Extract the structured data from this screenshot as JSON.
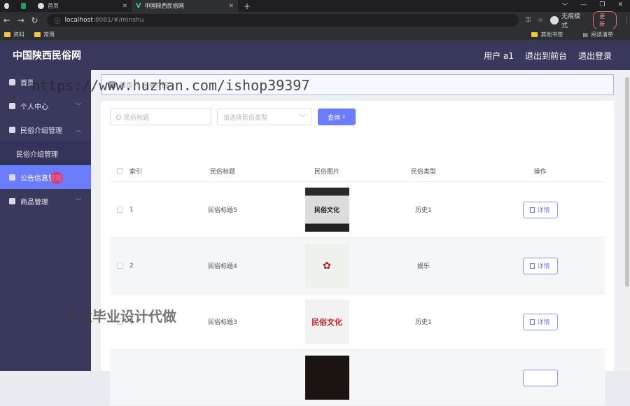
{
  "browser": {
    "tabs": [
      {
        "label": ""
      },
      {
        "label": ""
      },
      {
        "label": "首页"
      },
      {
        "label": "中国陕西民俗网"
      }
    ],
    "new_tab": "+",
    "window_controls": [
      "﹀",
      "—",
      "❐",
      "✕"
    ],
    "url_host": "localhost",
    "url_rest": ":8081/#/minshu",
    "incognito_label": "无痕模式",
    "update_label": "更新",
    "bookmarks": [
      "资料",
      "常用"
    ],
    "bookmarks_right": [
      "其他书签",
      "阅读清单"
    ]
  },
  "header": {
    "brand": "中国陕西民俗网",
    "user": "用户 a1",
    "back_front": "退出到前台",
    "logout": "退出登录"
  },
  "sidebar": {
    "items": [
      {
        "label": "首页",
        "icon": "home-icon"
      },
      {
        "label": "个人中心",
        "icon": "user-icon"
      },
      {
        "label": "民俗介绍管理",
        "icon": "clipboard-icon"
      },
      {
        "label": "民俗介绍管理",
        "icon": ""
      },
      {
        "label": "公告信息管理",
        "icon": "notice-icon"
      },
      {
        "label": "商品管理",
        "icon": "goods-icon"
      }
    ]
  },
  "breadcrumb": {
    "home": "首页",
    "current": "民俗介绍"
  },
  "search": {
    "title_placeholder": "民俗标题",
    "type_placeholder": "请选择民俗类型",
    "query_label": "查询"
  },
  "table": {
    "headers": {
      "index": "索引",
      "title": "民俗标题",
      "image": "民俗图片",
      "type": "民俗类型",
      "op": "操作"
    },
    "rows": [
      {
        "index": "1",
        "title": "民俗标题5",
        "image_text": "民俗文化",
        "type": "历史1",
        "detail": "详情"
      },
      {
        "index": "2",
        "title": "民俗标题4",
        "image_text": "✿",
        "type": "娱乐",
        "detail": "详情"
      },
      {
        "index": "3",
        "title": "民俗标题3",
        "image_text": "民俗文化",
        "type": "历史1",
        "detail": "详情"
      },
      {
        "index": "",
        "title": "",
        "image_text": "",
        "type": "",
        "detail": ""
      }
    ]
  },
  "watermarks": {
    "url": "https://www.huzhan.com/ishop39397",
    "promo": "专业毕业设计代做"
  }
}
